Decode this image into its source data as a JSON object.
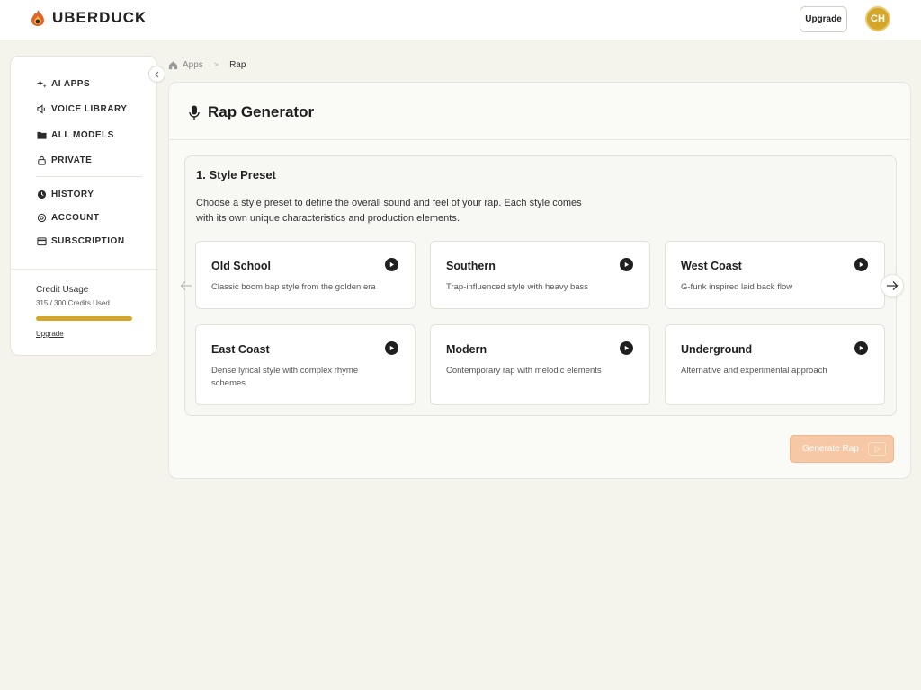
{
  "header": {
    "brand": "UBERDUCK",
    "logo_icon": "flame-duck-logo",
    "upgrade_label": "Upgrade",
    "avatar_initials": "CH"
  },
  "sidebar": {
    "items": [
      {
        "label": "AI APPS",
        "icon": "sparkles-icon"
      },
      {
        "label": "VOICE LIBRARY",
        "icon": "speaker-icon"
      },
      {
        "label": "ALL MODELS",
        "icon": "folder-icon"
      },
      {
        "label": "PRIVATE",
        "icon": "lock-icon"
      },
      {
        "label": "HISTORY",
        "icon": "clock-icon"
      },
      {
        "label": "ACCOUNT",
        "icon": "gear-icon"
      },
      {
        "label": "SUBSCRIPTION",
        "icon": "card-icon"
      }
    ],
    "credit": {
      "title": "Credit Usage",
      "used_text": "315 / 300 Credits Used",
      "fill_fraction": 1.0,
      "upgrade_link": "Upgrade"
    }
  },
  "breadcrumb": {
    "items": [
      "Apps",
      "Rap"
    ],
    "separator": ">"
  },
  "main": {
    "title": "Rap Generator",
    "section": {
      "title": "1. Style Preset",
      "description": "Choose a style preset to define the overall sound and feel of your rap. Each style comes with its own unique characteristics and production elements."
    },
    "presets": [
      {
        "name": "Old School",
        "desc": "Classic boom bap style from the golden era"
      },
      {
        "name": "Southern",
        "desc": "Trap-influenced style with heavy bass"
      },
      {
        "name": "West Coast",
        "desc": "G-funk inspired laid back flow"
      },
      {
        "name": "East Coast",
        "desc": "Dense lyrical style with complex rhyme schemes"
      },
      {
        "name": "Modern",
        "desc": "Contemporary rap with melodic elements"
      },
      {
        "name": "Underground",
        "desc": "Alternative and experimental approach"
      }
    ],
    "generate_label": "Generate Rap"
  },
  "colors": {
    "accent": "#d4a72c",
    "generate_button": "#f6c8a6",
    "background": "#f4f3ec"
  }
}
